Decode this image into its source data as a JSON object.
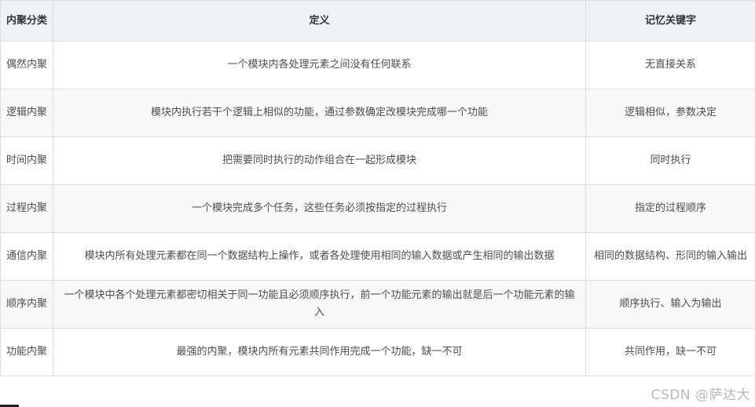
{
  "table": {
    "headers": [
      "内聚分类",
      "定义",
      "记忆关键字"
    ],
    "rows": [
      {
        "type": "偶然内聚",
        "definition": "一个模块内各处理元素之间没有任何联系",
        "keyword": "无直接关系"
      },
      {
        "type": "逻辑内聚",
        "definition": "模块内执行若干个逻辑上相似的功能，通过参数确定改模块完成哪一个功能",
        "keyword": "逻辑相似，参数决定"
      },
      {
        "type": "时间内聚",
        "definition": "把需要同时执行的动作组合在一起形成模块",
        "keyword": "同时执行"
      },
      {
        "type": "过程内聚",
        "definition": "一个模块完成多个任务，这些任务必须按指定的过程执行",
        "keyword": "指定的过程顺序"
      },
      {
        "type": "通信内聚",
        "definition": "模块内所有处理元素都在同一个数据结构上操作，或者各处理使用相同的输入数据或产生相同的输出数据",
        "keyword": "相同的数据结构、形同的输入输出"
      },
      {
        "type": "顺序内聚",
        "definition": "一个模块中各个处理元素都密切相关于同一功能且必须顺序执行，前一个功能元素的输出就是后一个功能元素的输入",
        "keyword": "顺序执行、输入为输出"
      },
      {
        "type": "功能内聚",
        "definition": "最强的内聚，模块内所有元素共同作用完成一个功能，缺一不可",
        "keyword": "共同作用，缺一不可"
      }
    ]
  },
  "watermark": "CSDN @萨达大"
}
